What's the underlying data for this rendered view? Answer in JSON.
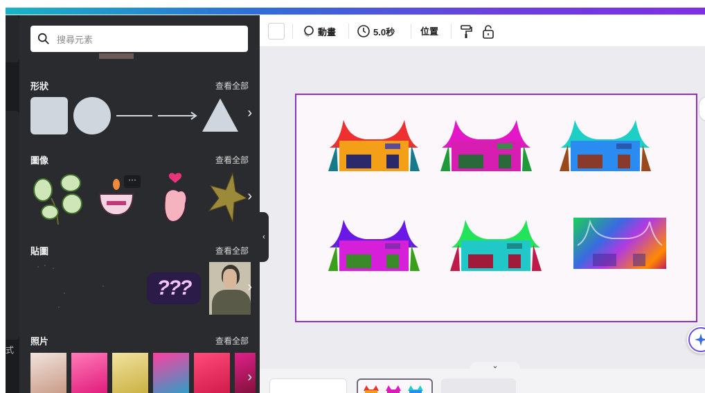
{
  "search": {
    "placeholder": "搜尋元素"
  },
  "sections": {
    "shapes": {
      "title": "形狀",
      "see_all": "查看全部"
    },
    "graphics": {
      "title": "圖像",
      "see_all": "查看全部"
    },
    "stickers": {
      "title": "貼圖",
      "see_all": "查看全部",
      "sticker_text": "???"
    },
    "photos": {
      "title": "照片",
      "see_all": "查看全部"
    }
  },
  "rail": {
    "partial_label": "式"
  },
  "toolbar": {
    "animate": "動畫",
    "duration": "5.0秒",
    "position": "位置"
  },
  "graphic_more": "···",
  "collapse_arrow": "‹",
  "bottom_toggle": "⌄",
  "chevron": "›",
  "colors": {
    "accent": "#8e2ec5",
    "panel": "#2a2b2f"
  },
  "houses": [
    {
      "roof": "#ee3030",
      "body": "#f3a018"
    },
    {
      "roof": "#e316c8",
      "body": "#d61fb0"
    },
    {
      "roof": "#1ecfc6",
      "body": "#2a8bf0"
    },
    {
      "roof": "#6a18e6",
      "body": "#d61fd8"
    },
    {
      "roof": "#22e35a",
      "body": "#20c8c8"
    },
    {
      "roof": "#ff8a00",
      "body": "#8a6ae0"
    }
  ]
}
